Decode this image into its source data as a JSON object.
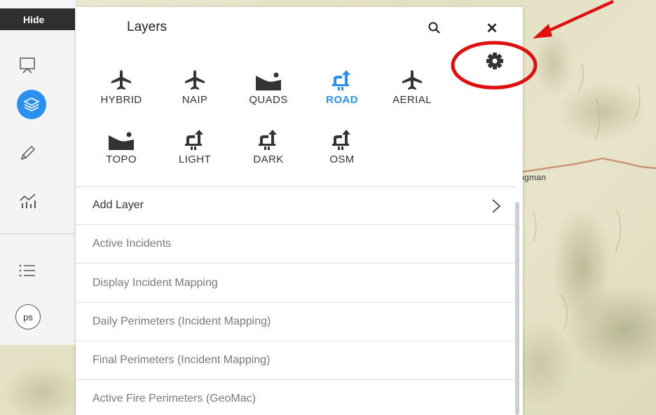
{
  "toolbar": {
    "hide_label": "Hide",
    "items": [
      {
        "icon": "presentation-icon"
      },
      {
        "icon": "layers-icon",
        "active": true
      },
      {
        "icon": "pencil-icon"
      },
      {
        "icon": "chart-icon"
      },
      {
        "icon": "list-icon"
      },
      {
        "icon": "ps-icon",
        "label": "ps"
      }
    ],
    "accent_color": "#2b8ff0"
  },
  "map": {
    "place_label": "ngman"
  },
  "panel": {
    "title": "Layers",
    "search_icon": "search-icon",
    "close_label": "✕",
    "settings_icon": "gear-icon",
    "basemaps": [
      {
        "label": "HYBRID",
        "icon": "plane-icon",
        "active": false
      },
      {
        "label": "NAIP",
        "icon": "plane-icon",
        "active": false
      },
      {
        "label": "QUADS",
        "icon": "terrain-icon",
        "active": false
      },
      {
        "label": "ROAD",
        "icon": "road-icon",
        "active": true
      },
      {
        "label": "AERIAL",
        "icon": "plane-icon",
        "active": false
      },
      {
        "label": "TOPO",
        "icon": "terrain-icon",
        "active": false
      },
      {
        "label": "LIGHT",
        "icon": "road-icon",
        "active": false
      },
      {
        "label": "DARK",
        "icon": "road-icon",
        "active": false
      },
      {
        "label": "OSM",
        "icon": "road-icon",
        "active": false
      }
    ],
    "layers": [
      {
        "label": "Add Layer",
        "primary": true
      },
      {
        "label": "Active Incidents"
      },
      {
        "label": "Display Incident Mapping"
      },
      {
        "label": "Daily Perimeters (Incident Mapping)"
      },
      {
        "label": "Final Perimeters (Incident Mapping)"
      },
      {
        "label": "Active Fire Perimeters (GeoMac)"
      }
    ]
  },
  "annotation": {
    "color": "#e01010"
  }
}
